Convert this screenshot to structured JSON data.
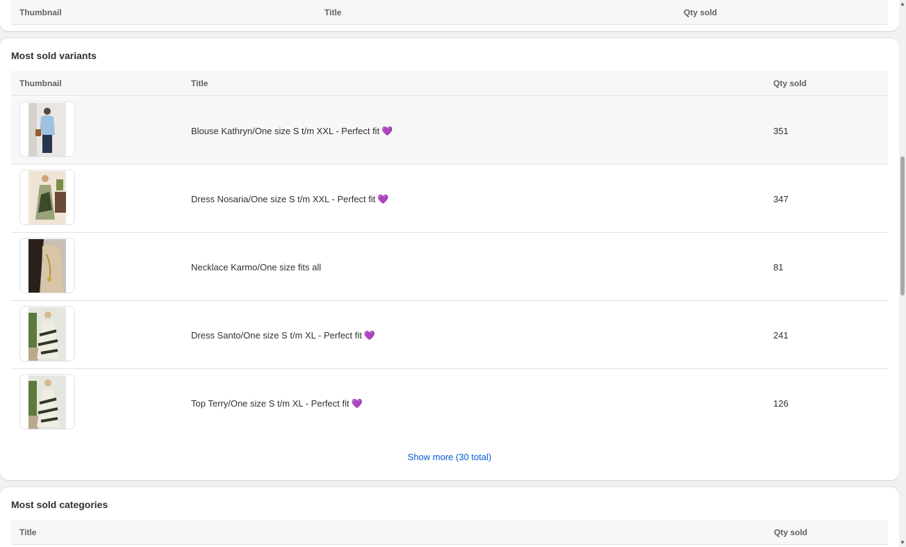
{
  "top_table": {
    "headers": {
      "thumbnail": "Thumbnail",
      "title": "Title",
      "qty": "Qty sold"
    }
  },
  "variants": {
    "title": "Most sold variants",
    "headers": {
      "thumbnail": "Thumbnail",
      "title": "Title",
      "qty": "Qty sold"
    },
    "rows": [
      {
        "title": "Blouse Kathryn/One size S t/m XXL - Perfect fit",
        "heart": "💜",
        "qty": "351"
      },
      {
        "title": "Dress Nosaria/One size S t/m XXL - Perfect fit",
        "heart": "💜",
        "qty": "347"
      },
      {
        "title": "Necklace Karmo/One size fits all",
        "heart": "",
        "qty": "81"
      },
      {
        "title": "Dress Santo/One size S t/m XL - Perfect fit",
        "heart": "💜",
        "qty": "241"
      },
      {
        "title": "Top Terry/One size S t/m XL - Perfect fit",
        "heart": "💜",
        "qty": "126"
      }
    ],
    "show_more": "Show more (30 total)"
  },
  "categories": {
    "title": "Most sold categories",
    "headers": {
      "title": "Title",
      "qty": "Qty sold"
    }
  }
}
